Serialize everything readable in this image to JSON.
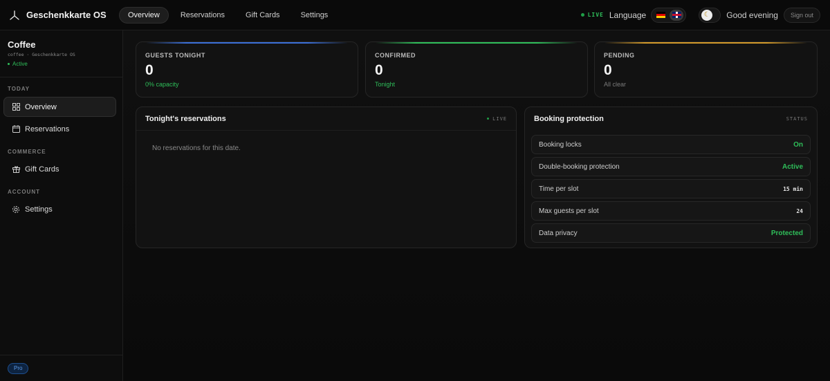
{
  "app": {
    "name": "Geschenkkarte OS"
  },
  "nav": {
    "tabs": [
      "Overview",
      "Reservations",
      "Gift Cards",
      "Settings"
    ],
    "active": "Overview"
  },
  "header": {
    "live": "LIVE",
    "language_label": "Language",
    "languages": [
      "de",
      "en"
    ],
    "active_language": "en",
    "greeting": "Good evening",
    "signout": "Sign out"
  },
  "workspace": {
    "name": "Coffee",
    "subtitle": "coffee · Geschenkkarte OS",
    "status": "Active"
  },
  "sidebar": {
    "sections": [
      {
        "label": "TODAY",
        "items": [
          {
            "label": "Overview",
            "icon": "grid-icon",
            "active": true
          },
          {
            "label": "Reservations",
            "icon": "calendar-icon"
          }
        ]
      },
      {
        "label": "COMMERCE",
        "items": [
          {
            "label": "Gift Cards",
            "icon": "gift-icon"
          }
        ]
      },
      {
        "label": "ACCOUNT",
        "items": [
          {
            "label": "Settings",
            "icon": "gear-icon"
          }
        ]
      }
    ],
    "plan_badge": "Pro"
  },
  "stats": [
    {
      "label": "GUESTS TONIGHT",
      "value": "0",
      "sub": "0% capacity",
      "accent": "#3b6fd8",
      "sub_color": "#2fbf5a"
    },
    {
      "label": "CONFIRMED",
      "value": "0",
      "sub": "Tonight",
      "accent": "#2fbf5a",
      "sub_color": "#2fbf5a"
    },
    {
      "label": "PENDING",
      "value": "0",
      "sub": "All clear",
      "accent": "#d39a2a",
      "sub_color": "#7a7a7a"
    }
  ],
  "reservations": {
    "title": "Tonight's reservations",
    "tag": "LIVE",
    "empty": "No reservations for this date."
  },
  "protection": {
    "title": "Booking protection",
    "tag": "STATUS",
    "rows": [
      {
        "label": "Booking locks",
        "value": "On"
      },
      {
        "label": "Double-booking protection",
        "value": "Active"
      },
      {
        "label": "Time per slot",
        "value": "15 min"
      },
      {
        "label": "Max guests per slot",
        "value": "24"
      },
      {
        "label": "Data privacy",
        "value": "Protected"
      }
    ]
  }
}
